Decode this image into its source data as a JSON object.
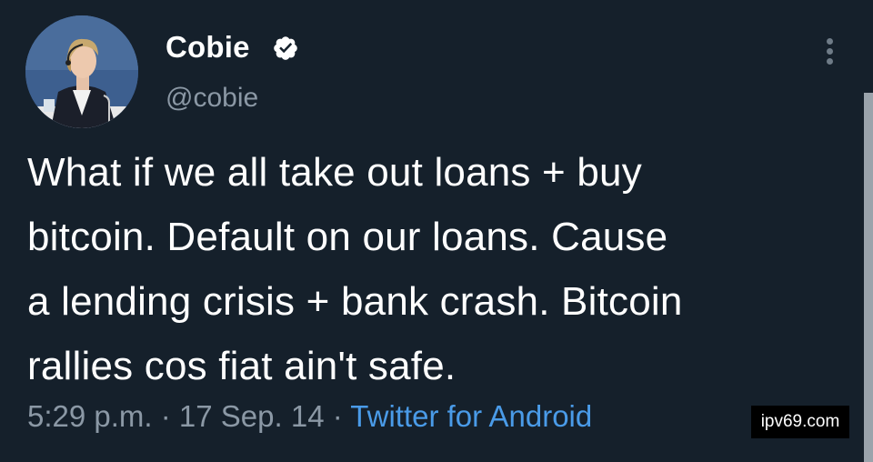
{
  "author": {
    "display_name": "Cobie",
    "handle": "@cobie",
    "avatar": "profile-photo",
    "verified": true,
    "verified_icon": "verified-badge-icon"
  },
  "menu": {
    "icon": "more-vertical-icon"
  },
  "tweet": {
    "lines": [
      "What if we all take out loans + buy",
      "bitcoin. Default on our loans. Cause",
      "a lending crisis + bank crash. Bitcoin",
      "rallies cos fiat ain't safe."
    ]
  },
  "meta": {
    "time": "5:29 p.m.",
    "separator": " · ",
    "date": "17 Sep. 14",
    "source": "Twitter for Android"
  },
  "watermark": "ipv69.com",
  "colors": {
    "background": "#15202b",
    "text": "#ffffff",
    "secondary": "#8b98a5",
    "link": "#4a9be8"
  }
}
